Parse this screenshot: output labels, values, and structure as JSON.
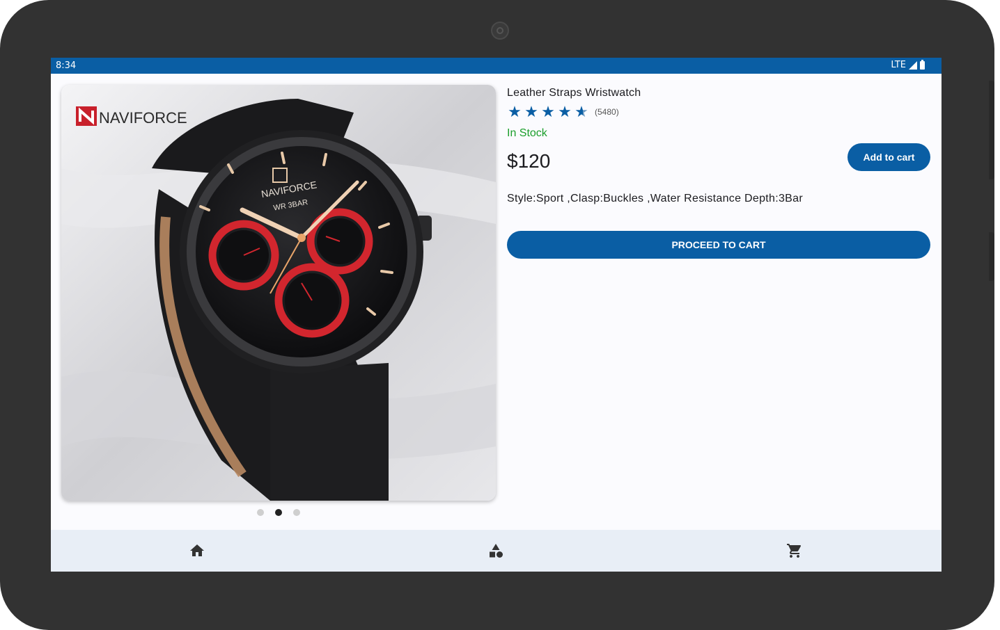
{
  "status_bar": {
    "time": "8:34",
    "network": "LTE"
  },
  "product": {
    "title": "Leather Straps Wristwatch",
    "rating": 4.5,
    "review_count": "(5480)",
    "stock_status": "In Stock",
    "price": "$120",
    "add_to_cart_label": "Add to cart",
    "description": "Style:Sport ,Clasp:Buckles ,Water Resistance Depth:3Bar",
    "proceed_label": "PROCEED TO CART",
    "image": {
      "brand_logo": "NAVIFORCE",
      "dial_text": "NAVIFORCE",
      "dial_subtext": "WR 3BAR"
    }
  },
  "carousel": {
    "count": 3,
    "active_index": 1
  },
  "bottom_nav": {
    "items": [
      "home-icon",
      "category-icon",
      "cart-icon"
    ]
  },
  "colors": {
    "primary": "#0a5ea4",
    "in_stock": "#1a9e2a",
    "nav_bg": "#e8eef6",
    "device_frame": "#323232"
  }
}
